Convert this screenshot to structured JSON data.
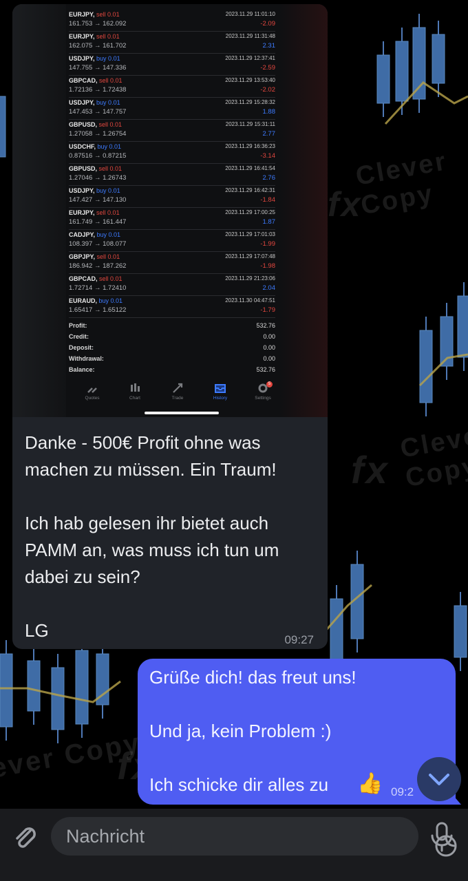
{
  "trades": [
    {
      "symbol": "EURJPY,",
      "side": "sell 0.01",
      "dir": "sell",
      "open": "161.753",
      "close": "162.092",
      "time": "2023.11.29 11:01:10",
      "profit": "-2.09"
    },
    {
      "symbol": "EURJPY,",
      "side": "sell 0.01",
      "dir": "sell",
      "open": "162.075",
      "close": "161.702",
      "time": "2023.11.29 11:31:48",
      "profit": "2.31"
    },
    {
      "symbol": "USDJPY,",
      "side": "buy 0.01",
      "dir": "buy",
      "open": "147.755",
      "close": "147.336",
      "time": "2023.11.29 12:37:41",
      "profit": "-2.59"
    },
    {
      "symbol": "GBPCAD,",
      "side": "sell 0.01",
      "dir": "sell",
      "open": "1.72136",
      "close": "1.72438",
      "time": "2023.11.29 13:53:40",
      "profit": "-2.02"
    },
    {
      "symbol": "USDJPY,",
      "side": "buy 0.01",
      "dir": "buy",
      "open": "147.453",
      "close": "147.757",
      "time": "2023.11.29 15:28:32",
      "profit": "1.88"
    },
    {
      "symbol": "GBPUSD,",
      "side": "sell 0.01",
      "dir": "sell",
      "open": "1.27058",
      "close": "1.26754",
      "time": "2023.11.29 15:31:11",
      "profit": "2.77"
    },
    {
      "symbol": "USDCHF,",
      "side": "buy 0.01",
      "dir": "buy",
      "open": "0.87516",
      "close": "0.87215",
      "time": "2023.11.29 16:36:23",
      "profit": "-3.14"
    },
    {
      "symbol": "GBPUSD,",
      "side": "sell 0.01",
      "dir": "sell",
      "open": "1.27046",
      "close": "1.26743",
      "time": "2023.11.29 16:41:54",
      "profit": "2.76"
    },
    {
      "symbol": "USDJPY,",
      "side": "buy 0.01",
      "dir": "buy",
      "open": "147.427",
      "close": "147.130",
      "time": "2023.11.29 16:42:31",
      "profit": "-1.84"
    },
    {
      "symbol": "EURJPY,",
      "side": "sell 0.01",
      "dir": "sell",
      "open": "161.749",
      "close": "161.447",
      "time": "2023.11.29 17:00:25",
      "profit": "1.87"
    },
    {
      "symbol": "CADJPY,",
      "side": "buy 0.01",
      "dir": "buy",
      "open": "108.397",
      "close": "108.077",
      "time": "2023.11.29 17:01:03",
      "profit": "-1.99"
    },
    {
      "symbol": "GBPJPY,",
      "side": "sell 0.01",
      "dir": "sell",
      "open": "186.942",
      "close": "187.262",
      "time": "2023.11.29 17:07:48",
      "profit": "-1.98"
    },
    {
      "symbol": "GBPCAD,",
      "side": "sell 0.01",
      "dir": "sell",
      "open": "1.72714",
      "close": "1.72410",
      "time": "2023.11.29 21:23:06",
      "profit": "2.04"
    },
    {
      "symbol": "EURAUD,",
      "side": "buy 0.01",
      "dir": "buy",
      "open": "1.65417",
      "close": "1.65122",
      "time": "2023.11.30 04:47:51",
      "profit": "-1.79"
    }
  ],
  "arrow": "→",
  "summary": [
    {
      "label": "Profit:",
      "value": "532.76"
    },
    {
      "label": "Credit:",
      "value": "0.00"
    },
    {
      "label": "Deposit:",
      "value": "0.00"
    },
    {
      "label": "Withdrawal:",
      "value": "0.00"
    },
    {
      "label": "Balance:",
      "value": "532.76"
    }
  ],
  "tabs": [
    {
      "label": "Quotes",
      "icon": "quotes-icon"
    },
    {
      "label": "Chart",
      "icon": "chart-icon"
    },
    {
      "label": "Trade",
      "icon": "trade-icon"
    },
    {
      "label": "History",
      "icon": "history-icon",
      "active": true
    },
    {
      "label": "Settings",
      "icon": "settings-icon",
      "badge": "5"
    }
  ],
  "incoming": {
    "text": "Danke - 500€ Profit ohne was machen zu müssen. Ein Traum!\n\nIch hab gelesen ihr bietet auch PAMM an, was muss ich tun um dabei zu sein?\n\nLG",
    "time": "09:27"
  },
  "outgoing": {
    "text": "Grüße dich! das freut uns!\n\nUnd ja, kein Problem :)\n\nIch schicke dir alles zu",
    "emoji": "👍",
    "time": "09:2"
  },
  "watermark": {
    "brand": "Clever Copy",
    "mark": "fx"
  },
  "composer": {
    "placeholder": "Nachricht"
  },
  "colors": {
    "accent_out": "#4f5df2",
    "bubble_in": "#202329",
    "sell": "#e2473f",
    "buy": "#3d7bff"
  }
}
